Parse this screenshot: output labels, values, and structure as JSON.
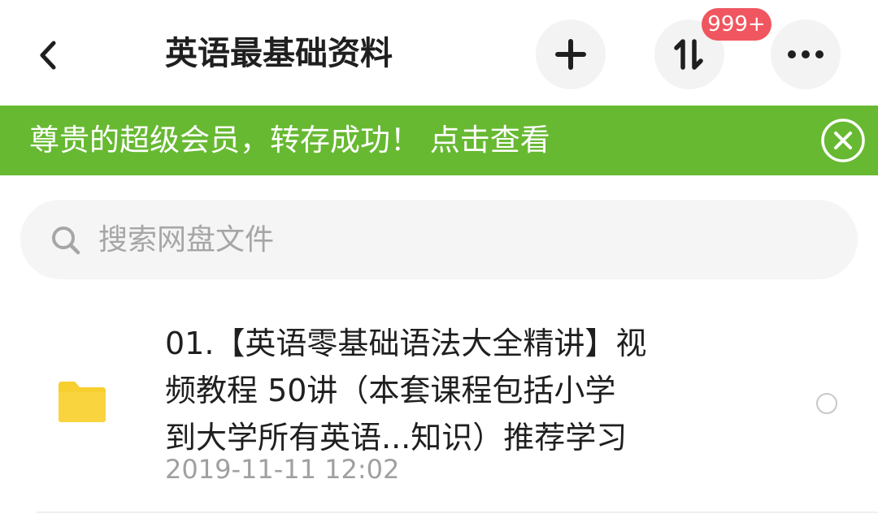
{
  "header": {
    "title": "英语最基础资料",
    "badge_count": "999+",
    "icons": {
      "back": "chevron-left-icon",
      "add": "plus-icon",
      "transfer": "transfer-sort-icon",
      "more": "more-dots-icon"
    }
  },
  "banner": {
    "message": "尊贵的超级会员，转存成功！ 点击查看",
    "background_color": "#67b932",
    "close_icon": "close-circle-icon"
  },
  "search": {
    "placeholder": "搜索网盘文件",
    "value": "",
    "icon": "search-icon"
  },
  "files": [
    {
      "name_lines": [
        "01.【英语零基础语法大全精讲】视",
        "频教程 50讲（本套课程包括小学",
        "到大学所有英语...知识）推荐学习"
      ],
      "date": "2019-11-11 12:02",
      "icon": "folder-icon",
      "icon_color": "#f7cf2e",
      "selected": false
    }
  ],
  "colors": {
    "badge": "#f0565f",
    "circle_button_bg": "#f3f3f4",
    "search_bg": "#f5f5f6"
  }
}
